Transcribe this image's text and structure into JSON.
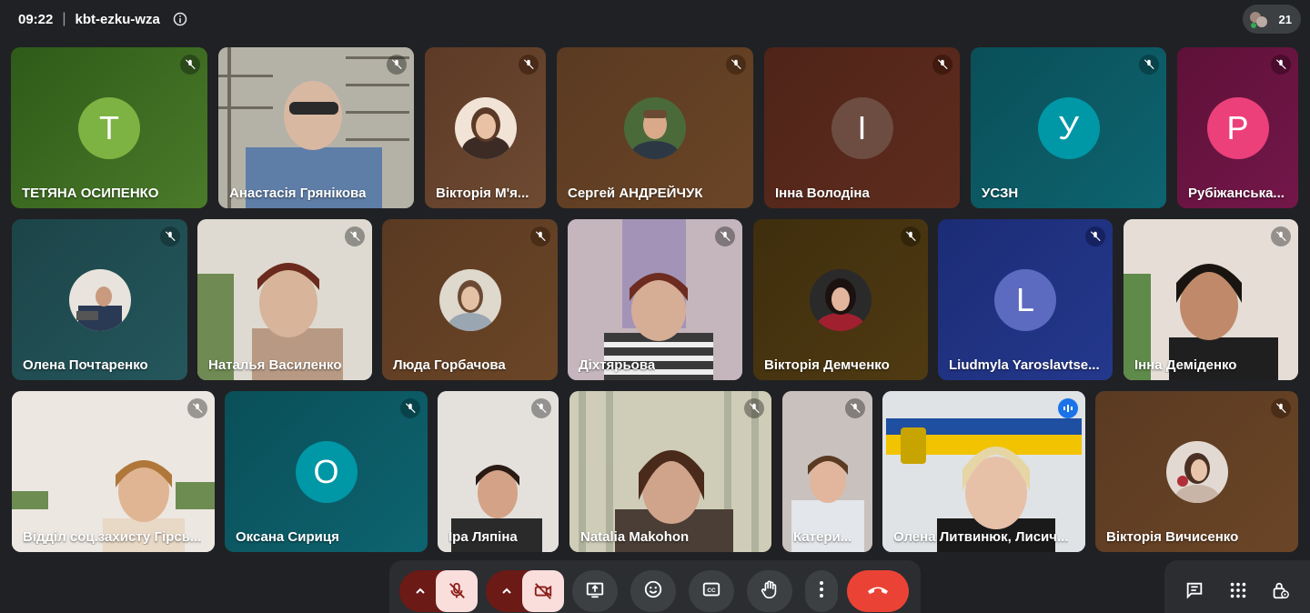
{
  "meeting": {
    "time": "09:22",
    "code": "kbt-ezku-wza",
    "participant_count": "21"
  },
  "icons": {
    "info": "info-icon",
    "mic_off": "mic-off-icon",
    "cam_off": "camera-off-icon",
    "present": "present-screen-icon",
    "emoji": "emoji-icon",
    "captions": "captions-icon",
    "hand": "raise-hand-icon",
    "more": "more-options-icon",
    "end": "end-call-icon",
    "chat": "chat-icon",
    "activities": "activities-icon",
    "host": "host-controls-icon",
    "speaking": "speaking-icon"
  },
  "colors": {
    "background": "#202124",
    "end_call": "#ea4335",
    "mic_muted_bg": "#f9dedc",
    "active_speaker": "#8ab4f8"
  },
  "tiles": [
    {
      "name": "ТЕТЯНА ОСИПЕНКО",
      "letter": "T",
      "bg": "#33691e",
      "avatar": "#7cb342"
    },
    {
      "name": "Анастасія Грянікова",
      "bg": "#8d8d85"
    },
    {
      "name": "Вікторія М'я...",
      "bg": "#5d3a26"
    },
    {
      "name": "Сергей АНДРЕЙЧУК",
      "bg": "#5a3a22"
    },
    {
      "name": "Інна Володіна",
      "letter": "І",
      "bg": "#5b2a1c",
      "avatar": "#6d4c41"
    },
    {
      "name": "УСЗН",
      "letter": "У",
      "bg": "#0b5963",
      "avatar": "#0097a7"
    },
    {
      "name": "Рубіжанська...",
      "letter": "Р",
      "bg": "#6a1340",
      "avatar": "#ec407a"
    },
    {
      "name": "Олена Почтаренко",
      "bg": "#1f4b50"
    },
    {
      "name": "Наталья Василенко",
      "bg": "#c9c5bb"
    },
    {
      "name": "Люда Горбачова",
      "bg": "#5a3a22"
    },
    {
      "name": "Діхтярьова",
      "bg": "#b7a6ad"
    },
    {
      "name": "Вікторія Демченко",
      "bg": "#4a3510"
    },
    {
      "name": "Liudmyla Yaroslavtse...",
      "letter": "L",
      "bg": "#1f2f7a",
      "avatar": "#5c6bc0"
    },
    {
      "name": "Інна Деміденко",
      "bg": "#d9cfc7"
    },
    {
      "name": "Відділ соц.захисту Гірсь...",
      "bg": "#e6e1da"
    },
    {
      "name": "Оксана Сириця",
      "letter": "О",
      "bg": "#0b5963",
      "avatar": "#0097a7"
    },
    {
      "name": "Іра Ляпіна",
      "bg": "#d2cfcb"
    },
    {
      "name": "Natalia Makohon",
      "bg": "#b8b9a8"
    },
    {
      "name": "Катери...",
      "bg": "#b8b1ae"
    },
    {
      "name": "Олена Литвинюк, Лисич...",
      "bg": "#cfd3d8"
    },
    {
      "name": "Вікторія Вичисенко",
      "bg": "#5a3a22"
    }
  ]
}
